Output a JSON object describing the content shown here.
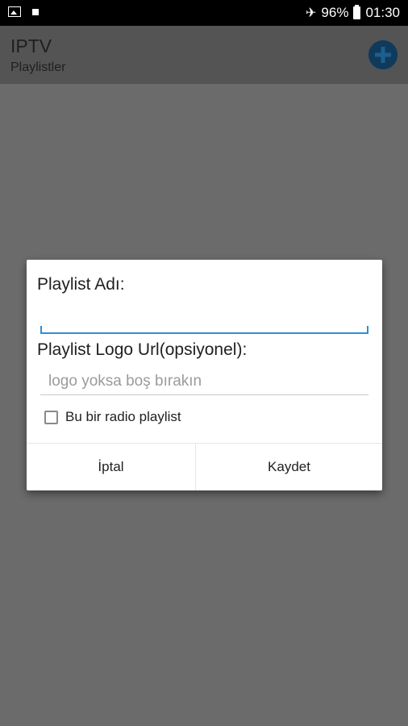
{
  "status_bar": {
    "battery_percent": "96%",
    "time": "01:30",
    "icons": [
      "photo-icon",
      "notification-square-icon",
      "airplane-icon",
      "battery-icon"
    ]
  },
  "app_bar": {
    "title": "IPTV",
    "subtitle": "Playlistler",
    "add_icon": "plus-circle-icon"
  },
  "dialog": {
    "name_label": "Playlist Adı:",
    "name_value": "",
    "logo_label": "Playlist Logo Url(opsiyonel):",
    "logo_placeholder": "logo yoksa boş bırakın",
    "logo_value": "",
    "radio_checkbox_label": "Bu bir radio playlist",
    "radio_checked": false,
    "cancel_label": "İptal",
    "save_label": "Kaydet"
  },
  "colors": {
    "accent": "#2d8fd5",
    "overlay": "#6b6b6b",
    "fab": "#0f3a5c"
  }
}
